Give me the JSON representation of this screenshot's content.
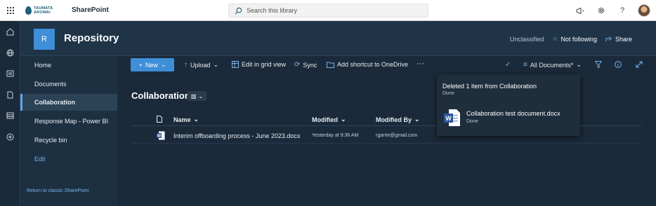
{
  "app": {
    "brand": "SharePoint",
    "logo_text": [
      "TAUMATA",
      "AROWAI"
    ]
  },
  "search": {
    "placeholder": "Search this library"
  },
  "header": {
    "site_initial": "R",
    "site_title": "Repository",
    "classification": "Unclassified",
    "follow_label": "Not following",
    "share_label": "Share"
  },
  "nav": {
    "items": [
      "Home",
      "Documents",
      "Collaboration",
      "Response Map - Power BI",
      "Recycle bin"
    ],
    "active": "Collaboration",
    "edit_label": "Edit",
    "classic_link": "Return to classic SharePoint"
  },
  "toolbar": {
    "new_label": "New",
    "upload_label": "Upload",
    "grid_label": "Edit in grid view",
    "sync_label": "Sync",
    "shortcut_label": "Add shortcut to OneDrive",
    "more_label": "···",
    "view_label": "All Documents*"
  },
  "library": {
    "title": "Collaboration",
    "columns": {
      "name": "Name",
      "modified": "Modified",
      "modified_by": "Modified By"
    },
    "rows": [
      {
        "name": "Interim offboarding process - June 2023.docx",
        "modified": "Yesterday at 9:36 AM",
        "modified_by": "rgarrie@gmail.com"
      }
    ]
  },
  "notification": {
    "title": "Deleted 1 item from Collaboration",
    "status": "Done",
    "file_name": "Collaboration test document.docx",
    "file_status": "Done"
  },
  "colors": {
    "accent": "#3f8ed8",
    "background": "#1b2a3a",
    "header": "#1f3447"
  },
  "icons": [
    "waffle-icon",
    "home-icon",
    "globe-icon",
    "news-icon",
    "document-icon",
    "list-icon",
    "add-circle-icon",
    "megaphone-icon",
    "gear-icon",
    "help-icon",
    "star-icon",
    "share-icon",
    "upload-icon",
    "grid-icon",
    "sync-icon",
    "shortcut-icon",
    "check-icon",
    "filter-icon",
    "info-icon",
    "expand-icon",
    "word-icon"
  ]
}
